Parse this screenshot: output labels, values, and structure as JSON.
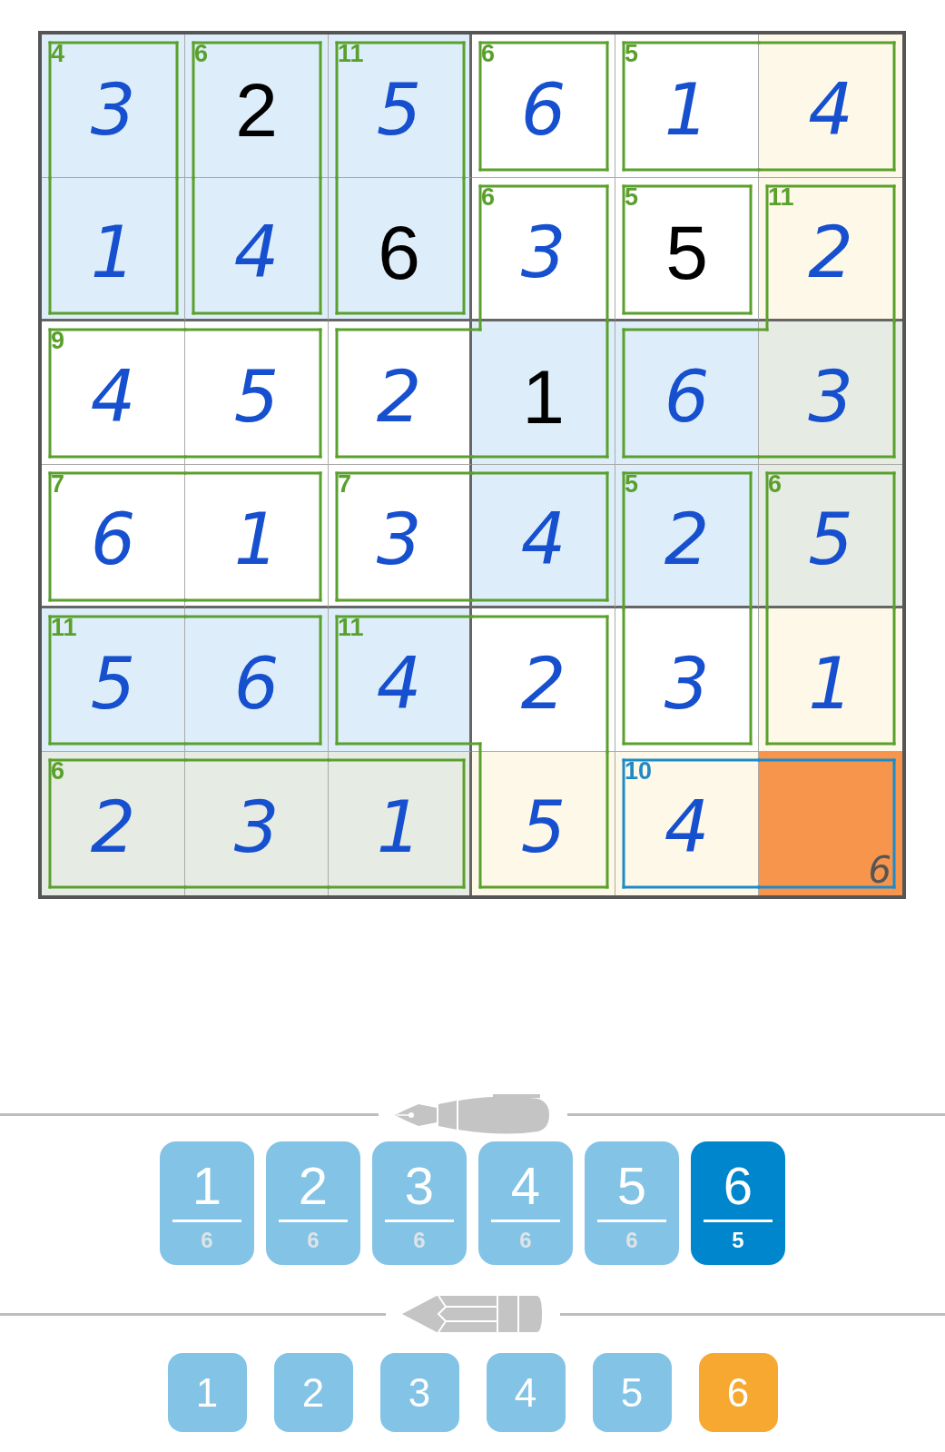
{
  "grid": {
    "rows": [
      [
        {
          "value": "3",
          "given": false,
          "color": "#ddeefa",
          "selected": false,
          "cage_sum": "4",
          "cage_selected": false,
          "kind": "trl"
        },
        {
          "value": "2",
          "given": true,
          "color": "#ddeefa",
          "selected": false,
          "cage_sum": "6",
          "cage_selected": false,
          "kind": "trl"
        },
        {
          "value": "5",
          "given": false,
          "color": "#ddeefa",
          "selected": false,
          "cage_sum": "11",
          "cage_selected": false,
          "kind": "trl"
        },
        {
          "value": "6",
          "given": false,
          "color": "#ffffff",
          "selected": false,
          "cage_sum": "6",
          "cage_selected": false,
          "kind": "trbl"
        },
        {
          "value": "1",
          "given": false,
          "color": "#ffffff",
          "selected": false,
          "cage_sum": "5",
          "cage_selected": false,
          "kind": "tbl"
        },
        {
          "value": "4",
          "given": false,
          "color": "#fdf8e7",
          "selected": false,
          "cage_selected": false,
          "kind": "trb"
        }
      ],
      [
        {
          "value": "1",
          "given": false,
          "color": "#ddeefa",
          "selected": false,
          "cage_selected": false,
          "kind": "rbl"
        },
        {
          "value": "4",
          "given": false,
          "color": "#ddeefa",
          "selected": false,
          "cage_selected": false,
          "kind": "rbl"
        },
        {
          "value": "6",
          "given": true,
          "color": "#ddeefa",
          "selected": false,
          "cage_selected": false,
          "kind": "rbl"
        },
        {
          "value": "3",
          "given": false,
          "color": "#ffffff",
          "selected": false,
          "cage_sum": "6",
          "cage_selected": false,
          "kind": "trl"
        },
        {
          "value": "5",
          "given": true,
          "color": "#ffffff",
          "selected": false,
          "cage_sum": "5",
          "cage_selected": false,
          "kind": "trbl"
        },
        {
          "value": "2",
          "given": false,
          "color": "#fdf8e7",
          "selected": false,
          "cage_sum": "11",
          "cage_selected": false,
          "kind": "trl"
        }
      ],
      [
        {
          "value": "4",
          "given": false,
          "color": "#ffffff",
          "selected": false,
          "cage_sum": "9",
          "cage_selected": false,
          "kind": "tbl"
        },
        {
          "value": "5",
          "given": false,
          "color": "#ffffff",
          "selected": false,
          "cage_selected": false,
          "kind": "trb"
        },
        {
          "value": "2",
          "given": false,
          "color": "#ffffff",
          "selected": false,
          "cage_selected": false,
          "kind": "tbl"
        },
        {
          "value": "1",
          "given": true,
          "color": "#ddeefa",
          "selected": false,
          "cage_selected": false,
          "kind": "rb"
        },
        {
          "value": "6",
          "given": false,
          "color": "#ddeefa",
          "selected": false,
          "cage_selected": false,
          "kind": "tbl"
        },
        {
          "value": "3",
          "given": false,
          "color": "#e6ece4",
          "selected": false,
          "cage_selected": false,
          "kind": "rb"
        }
      ],
      [
        {
          "value": "6",
          "given": false,
          "color": "#ffffff",
          "selected": false,
          "cage_sum": "7",
          "cage_selected": false,
          "kind": "tbl"
        },
        {
          "value": "1",
          "given": false,
          "color": "#ffffff",
          "selected": false,
          "cage_selected": false,
          "kind": "trb"
        },
        {
          "value": "3",
          "given": false,
          "color": "#ffffff",
          "selected": false,
          "cage_sum": "7",
          "cage_selected": false,
          "kind": "tbl"
        },
        {
          "value": "4",
          "given": false,
          "color": "#ddeefa",
          "selected": false,
          "cage_selected": false,
          "kind": "trb"
        },
        {
          "value": "2",
          "given": false,
          "color": "#ddeefa",
          "selected": false,
          "cage_sum": "5",
          "cage_selected": false,
          "kind": "trl"
        },
        {
          "value": "5",
          "given": false,
          "color": "#e6ece4",
          "selected": false,
          "cage_sum": "6",
          "cage_selected": false,
          "kind": "trl"
        }
      ],
      [
        {
          "value": "5",
          "given": false,
          "color": "#ddeefa",
          "selected": false,
          "cage_sum": "11",
          "cage_selected": false,
          "kind": "tbl"
        },
        {
          "value": "6",
          "given": false,
          "color": "#ddeefa",
          "selected": false,
          "cage_selected": false,
          "kind": "trb"
        },
        {
          "value": "4",
          "given": false,
          "color": "#ddeefa",
          "selected": false,
          "cage_sum": "11",
          "cage_selected": false,
          "kind": "tbl"
        },
        {
          "value": "2",
          "given": false,
          "color": "#ffffff",
          "selected": false,
          "cage_selected": false,
          "kind": "tr"
        },
        {
          "value": "3",
          "given": false,
          "color": "#ffffff",
          "selected": false,
          "cage_selected": false,
          "kind": "rbl"
        },
        {
          "value": "1",
          "given": false,
          "color": "#fdf8e7",
          "selected": false,
          "cage_selected": false,
          "kind": "rbl"
        }
      ],
      [
        {
          "value": "2",
          "given": false,
          "color": "#e6ece4",
          "selected": false,
          "cage_sum": "6",
          "cage_selected": false,
          "kind": "tbl"
        },
        {
          "value": "3",
          "given": false,
          "color": "#e6ece4",
          "selected": false,
          "cage_selected": false,
          "kind": "tb"
        },
        {
          "value": "1",
          "given": false,
          "color": "#e6ece4",
          "selected": false,
          "cage_selected": false,
          "kind": "trb"
        },
        {
          "value": "5",
          "given": false,
          "color": "#fdf8e7",
          "selected": false,
          "cage_selected": false,
          "kind": "rbl"
        },
        {
          "value": "4",
          "given": false,
          "color": "#fdf8e7",
          "selected": false,
          "cage_sum": "10",
          "cage_selected": true,
          "kind": "tbl"
        },
        {
          "notes": [
            "6"
          ],
          "selected": true,
          "cage_selected": true,
          "kind": "trb"
        }
      ]
    ]
  },
  "pen_keys": [
    {
      "digit": "1",
      "count": "6",
      "selected": false
    },
    {
      "digit": "2",
      "count": "6",
      "selected": false
    },
    {
      "digit": "3",
      "count": "6",
      "selected": false
    },
    {
      "digit": "4",
      "count": "6",
      "selected": false
    },
    {
      "digit": "5",
      "count": "6",
      "selected": false
    },
    {
      "digit": "6",
      "count": "5",
      "selected": true
    }
  ],
  "pencil_keys": [
    {
      "digit": "1",
      "selected": false
    },
    {
      "digit": "2",
      "selected": false
    },
    {
      "digit": "3",
      "selected": false
    },
    {
      "digit": "4",
      "selected": false
    },
    {
      "digit": "5",
      "selected": false
    },
    {
      "digit": "6",
      "selected": true
    }
  ]
}
